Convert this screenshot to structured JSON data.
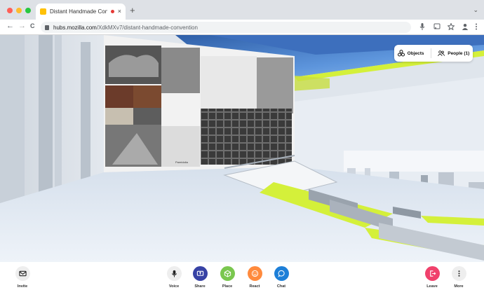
{
  "browser": {
    "tab_title": "Distant Handmade Conver",
    "tab_close": "×",
    "new_tab": "+",
    "tab_menu": "⌄",
    "url_host": "hubs.mozilla.com",
    "url_path": "/XdkMXv7/distant-handmade-convention"
  },
  "nav": {
    "back": "←",
    "forward": "→",
    "reload": "C"
  },
  "chrome_icons": [
    "microphone-icon",
    "cast-icon",
    "star-icon",
    "profile-icon",
    "kebab-icon"
  ],
  "scene": {
    "poster_caption": "Pareidolia",
    "objects_label": "Objects",
    "people_label": "People (1)"
  },
  "toolbar": {
    "invite_label": "Invite",
    "voice_label": "Voice",
    "share_label": "Share",
    "place_label": "Place",
    "react_label": "React",
    "chat_label": "Chat",
    "leave_label": "Leave",
    "more_label": "More"
  },
  "colors": {
    "share": "#3742a5",
    "place": "#7ac74f",
    "react": "#ff8a3d",
    "chat": "#1d7fd8",
    "leave": "#f0416c",
    "neutral": "#eeeeee",
    "accent_yellow": "#d4f03a",
    "sky": "#4a86d4"
  }
}
